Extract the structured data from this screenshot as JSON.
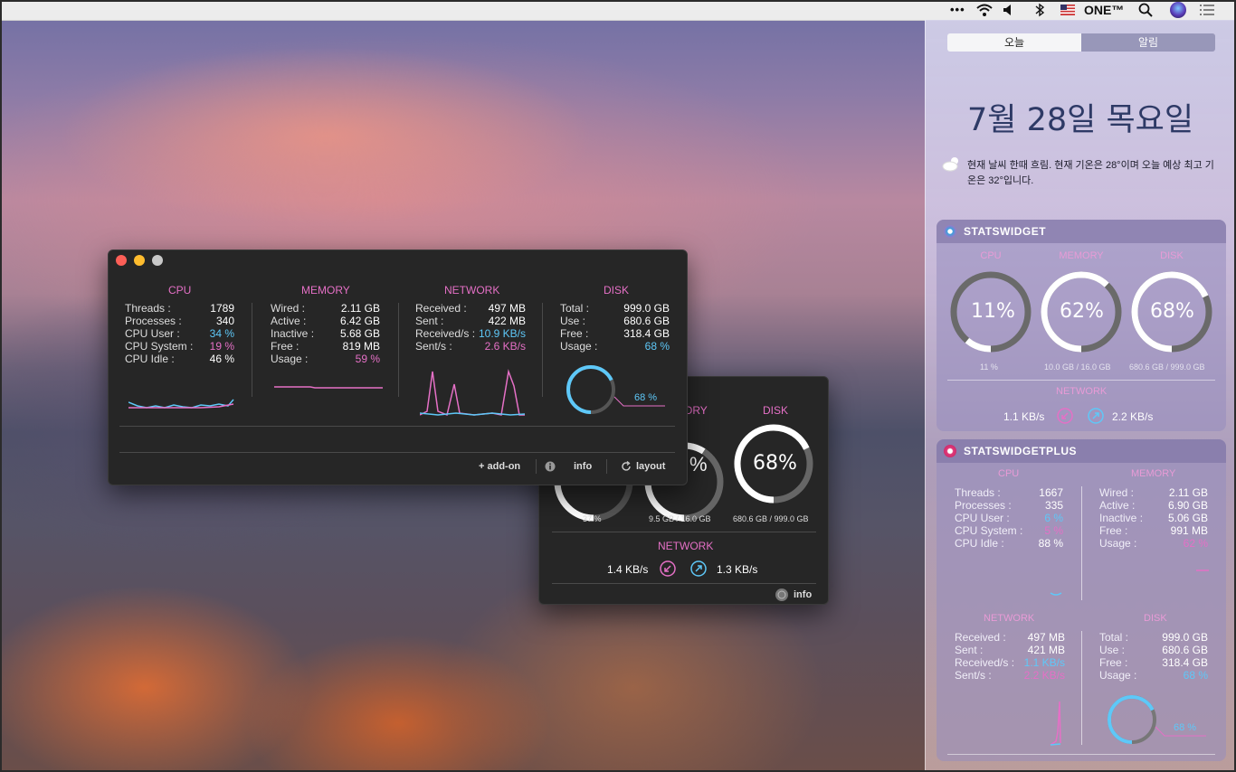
{
  "menubar": {
    "dots": "•••",
    "input_label": "ONE™",
    "icons": [
      "wifi-icon",
      "volume-icon",
      "bluetooth-icon",
      "flag-icon",
      "search-icon",
      "siri-icon",
      "list-icon"
    ]
  },
  "nc": {
    "tabs": [
      "오늘",
      "알림"
    ],
    "date": "7월 28일 목요일",
    "weather": "현재 날씨 한때 흐림. 현재 기온은 28°이며 오늘 예상 최고 기온은 32°입니다.",
    "statswidget": {
      "title": "STATSWIDGET",
      "cpu": {
        "label": "CPU",
        "pct": "11%",
        "value": 11,
        "sub": "11 %"
      },
      "memory": {
        "label": "MEMORY",
        "pct": "62%",
        "value": 62,
        "sub": "10.0 GB / 16.0 GB"
      },
      "disk": {
        "label": "DISK",
        "pct": "68%",
        "value": 68,
        "sub": "680.6 GB / 999.0 GB"
      },
      "network_label": "NETWORK",
      "down": "1.1 KB/s",
      "up": "2.2 KB/s"
    },
    "statswidgetplus": {
      "title": "STATSWIDGETPLUS",
      "cpu_title": "CPU",
      "cpu": [
        [
          "Threads :",
          "1667"
        ],
        [
          "Processes :",
          "335"
        ],
        [
          "CPU User :",
          "6 %"
        ],
        [
          "CPU System :",
          "5 %"
        ],
        [
          "CPU Idle :",
          "88 %"
        ]
      ],
      "memory_title": "MEMORY",
      "memory": [
        [
          "Wired :",
          "2.11 GB"
        ],
        [
          "Active :",
          "6.90 GB"
        ],
        [
          "Inactive :",
          "5.06 GB"
        ],
        [
          "Free :",
          "991 MB"
        ],
        [
          "Usage :",
          "62 %"
        ]
      ],
      "network_title": "NETWORK",
      "network": [
        [
          "Received :",
          "497 MB"
        ],
        [
          "Sent :",
          "421 MB"
        ],
        [
          "Received/s :",
          "1.1 KB/s"
        ],
        [
          "Sent/s :",
          "2.2 KB/s"
        ]
      ],
      "disk_title": "DISK",
      "disk": [
        [
          "Total :",
          "999.0 GB"
        ],
        [
          "Use :",
          "680.6 GB"
        ],
        [
          "Free :",
          "318.4 GB"
        ],
        [
          "Usage :",
          "68 %"
        ]
      ],
      "disk_gauge_label": "68 %",
      "disk_value": 68
    }
  },
  "main_window": {
    "cpu_title": "CPU",
    "cpu": [
      [
        "Threads :",
        "1789"
      ],
      [
        "Processes :",
        "340"
      ],
      [
        "CPU User :",
        "34 %"
      ],
      [
        "CPU System :",
        "19 %"
      ],
      [
        "CPU Idle :",
        "46 %"
      ]
    ],
    "memory_title": "MEMORY",
    "memory": [
      [
        "Wired :",
        "2.11 GB"
      ],
      [
        "Active :",
        "6.42 GB"
      ],
      [
        "Inactive :",
        "5.68 GB"
      ],
      [
        "Free :",
        "819 MB"
      ],
      [
        "Usage :",
        "59 %"
      ]
    ],
    "network_title": "NETWORK",
    "network": [
      [
        "Received :",
        "497 MB"
      ],
      [
        "Sent :",
        "422 MB"
      ],
      [
        "Received/s :",
        "10.9 KB/s"
      ],
      [
        "Sent/s :",
        "2.6 KB/s"
      ]
    ],
    "disk_title": "DISK",
    "disk": [
      [
        "Total :",
        "999.0 GB"
      ],
      [
        "Use :",
        "680.6 GB"
      ],
      [
        "Free :",
        "318.4 GB"
      ],
      [
        "Usage :",
        "68 %"
      ]
    ],
    "disk_gauge_label": "68 %",
    "disk_value": 68,
    "buttons": {
      "addon": "+ add-on",
      "info": "info",
      "layout": "layout"
    }
  },
  "back_window": {
    "memory_label_partial": "ORY",
    "disk_label": "DISK",
    "disk_pct": "68%",
    "disk_value": 68,
    "memory_value": 59,
    "cpu_sub": "37 %",
    "memory_sub": "9.5 GB / 16.0 GB",
    "disk_sub": "680.6 GB / 999.0 GB",
    "network_label": "NETWORK",
    "down": "1.4 KB/s",
    "up": "1.3 KB/s",
    "info": "info"
  },
  "colors": {
    "pink": "#e570c6",
    "blue": "#5ec8f8",
    "dark": "#262626"
  }
}
